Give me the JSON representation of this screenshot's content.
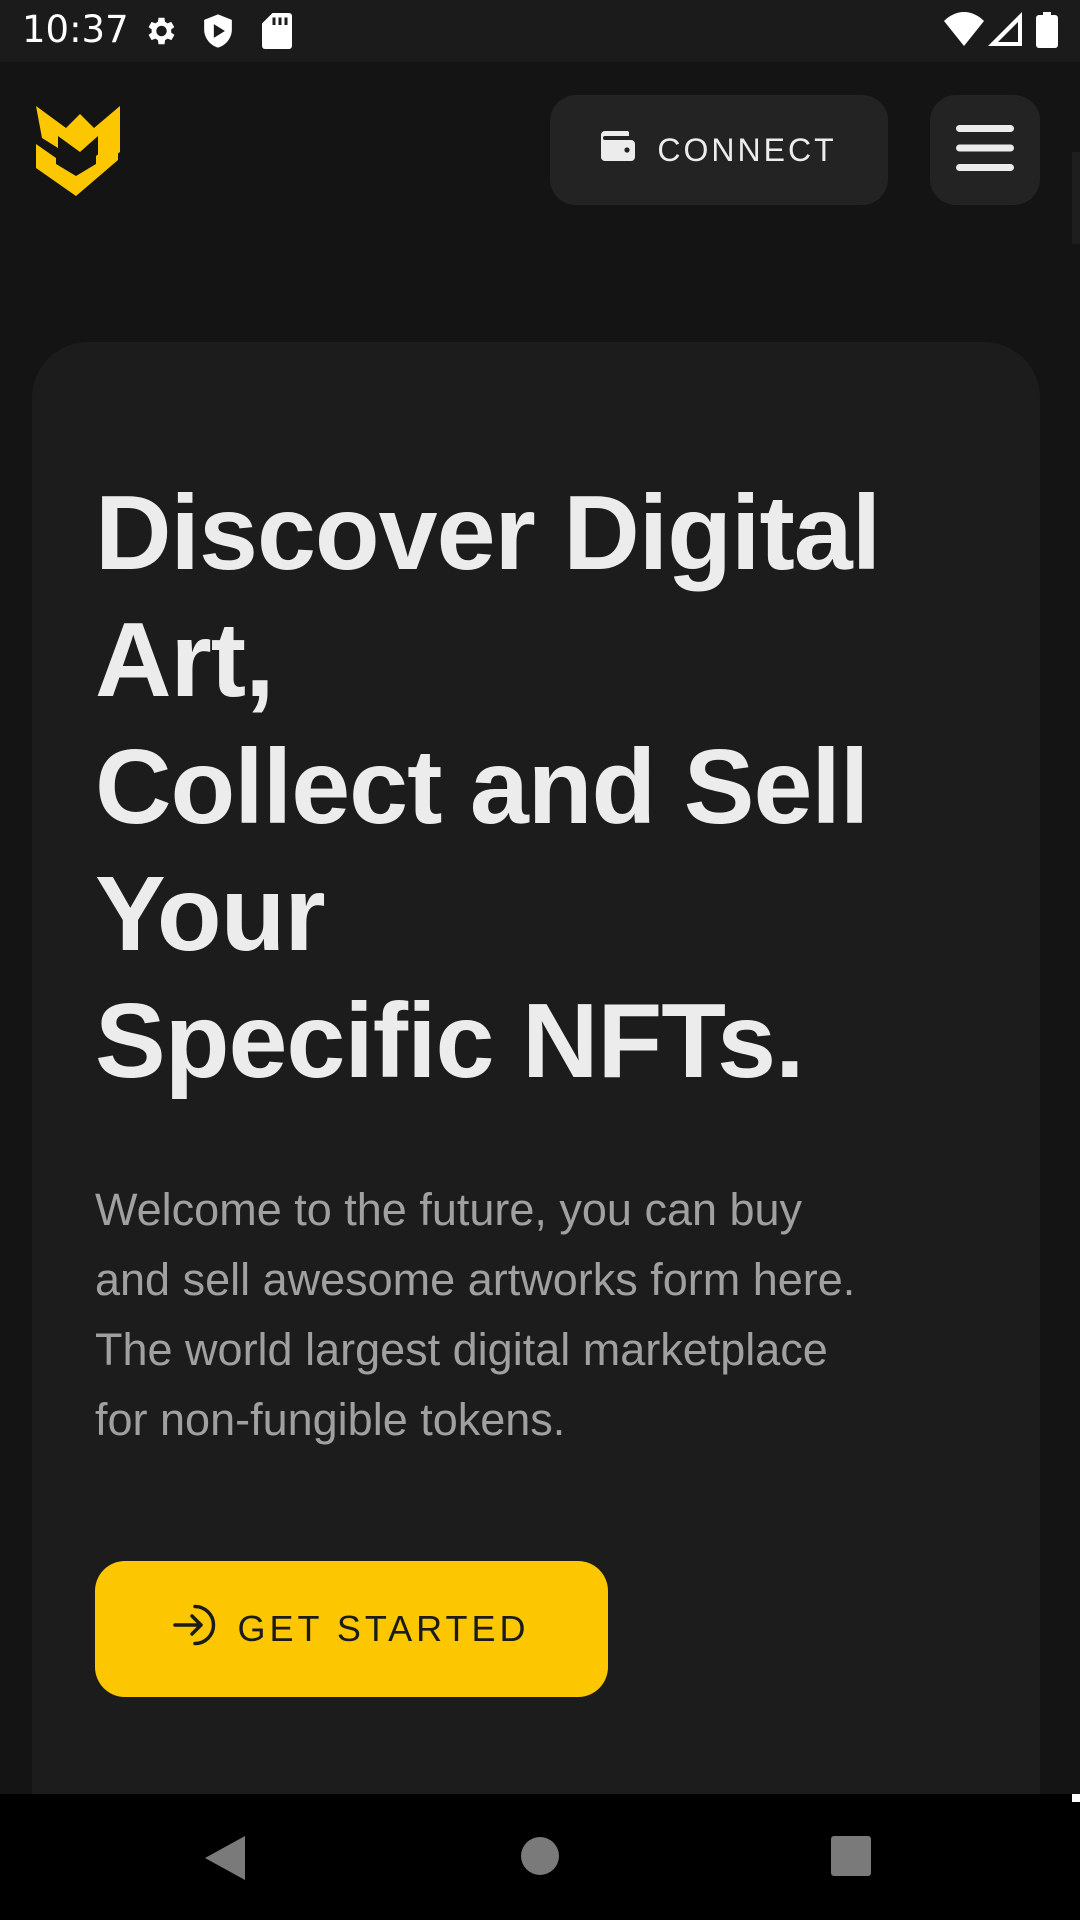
{
  "status_bar": {
    "time": "10:37",
    "left_icons": [
      "gear-icon",
      "shield-icon",
      "sd-card-icon"
    ],
    "right_icons": [
      "wifi-icon",
      "cell-signal-icon",
      "battery-icon"
    ]
  },
  "header": {
    "logo_icon": "brand-logo-icon",
    "connect_label": "CONNECT",
    "connect_icon": "wallet-icon",
    "menu_icon": "hamburger-menu-icon"
  },
  "hero": {
    "title_lines": [
      "Discover Digital",
      "Art,",
      "Collect and Sell",
      "Your",
      "Specific NFTs."
    ],
    "description_lines": [
      "Welcome to the future, you can buy",
      "and sell awesome artworks form here.",
      "The world largest digital marketplace",
      "for non-fungible tokens."
    ],
    "cta_label": "GET STARTED",
    "cta_icon": "arrow-login-icon"
  },
  "nav_bar": {
    "buttons": [
      "back-icon",
      "home-icon",
      "recents-icon"
    ]
  },
  "colors": {
    "background": "#141414",
    "card": "#1c1c1d",
    "accent": "#fdc700",
    "title_text": "#ececec",
    "body_text": "#a0a0a0"
  }
}
